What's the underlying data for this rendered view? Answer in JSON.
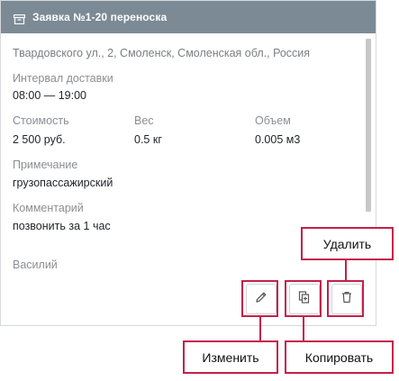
{
  "card": {
    "title": "Заявка №1-20 переноска",
    "header_icon": "archive-box-icon",
    "address": "Твардовского ул., 2, Смоленск, Смоленская обл., Россия",
    "interval_label": "Интервал доставки",
    "interval_value": "08:00 — 19:00",
    "cost_label": "Стоимость",
    "cost_value": "2 500 руб.",
    "weight_label": "Вес",
    "weight_value": "0.5 кг",
    "volume_label": "Объем",
    "volume_value": "0.005 м3",
    "note_label": "Примечание",
    "note_value": "грузопассажирский",
    "comment_label": "Комментарий",
    "comment_value": "позвонить за 1 час",
    "person": "Василий"
  },
  "actions": {
    "edit_icon": "pencil-icon",
    "copy_icon": "copy-icon",
    "delete_icon": "trash-icon"
  },
  "callouts": {
    "delete": "Удалить",
    "edit": "Изменить",
    "copy": "Копировать"
  },
  "colors": {
    "header_bg": "#7c8a96",
    "callout_border": "#c4204a"
  }
}
